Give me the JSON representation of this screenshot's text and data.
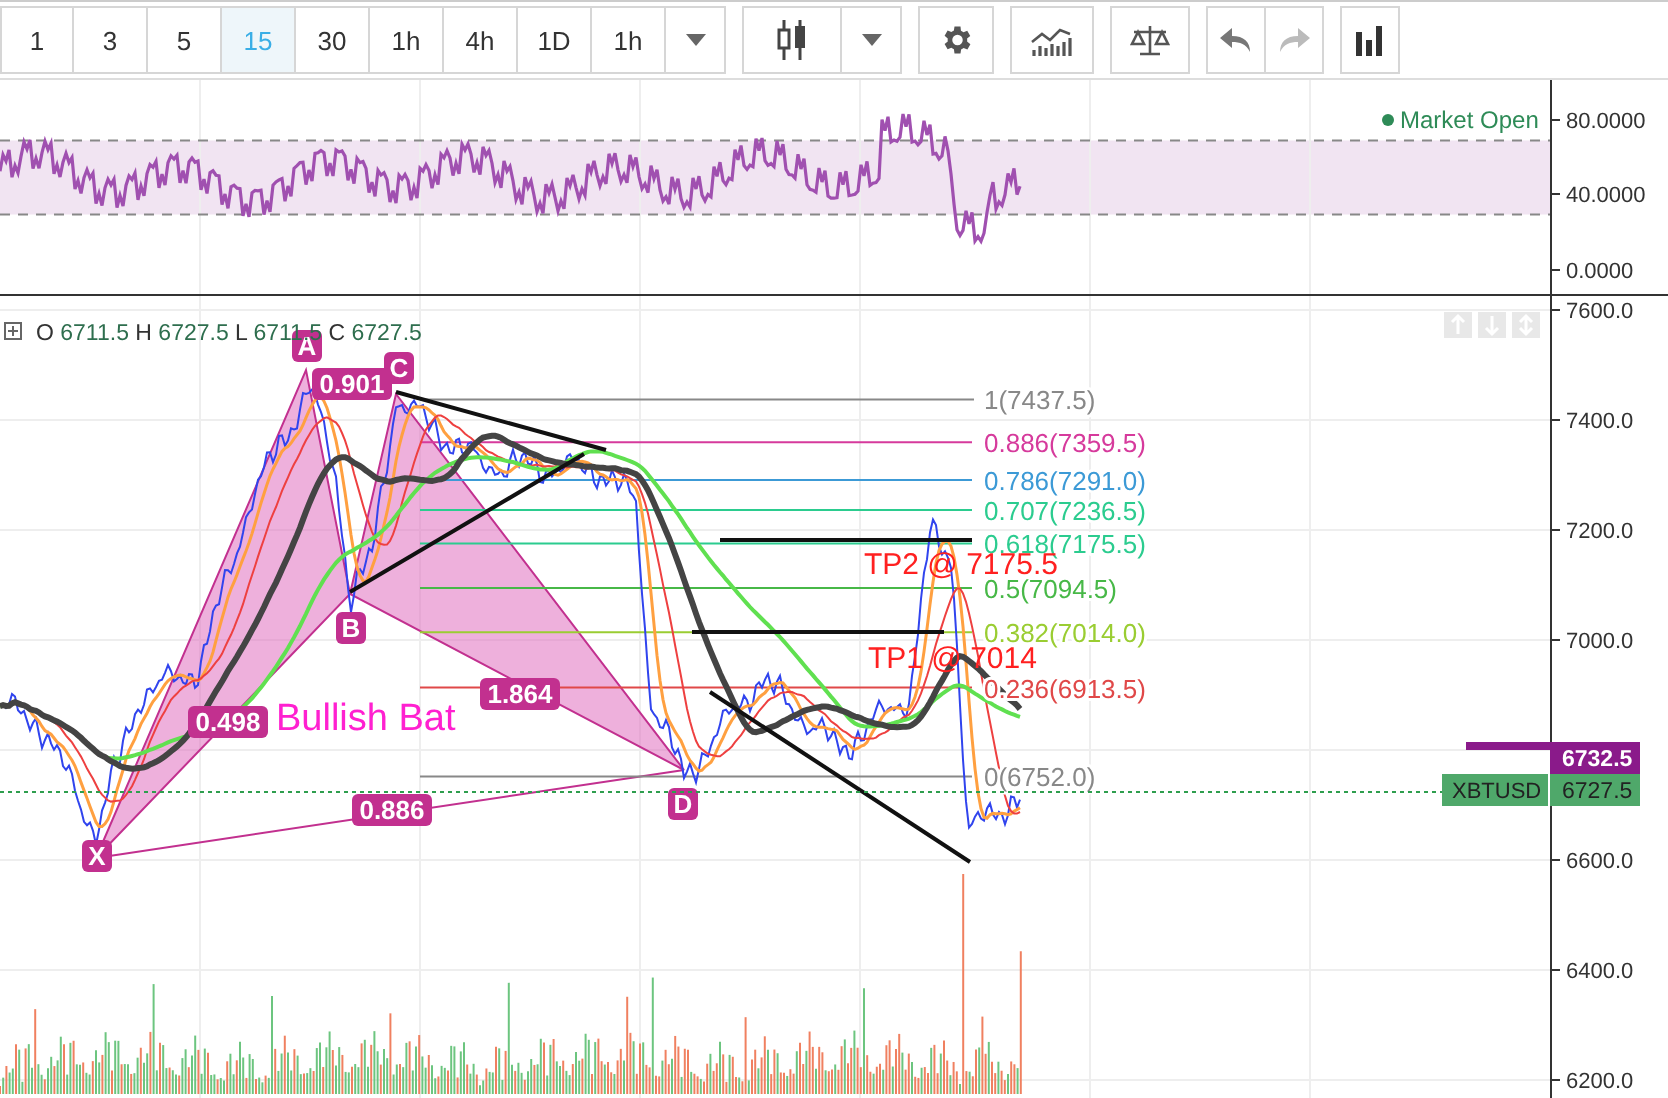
{
  "toolbar": {
    "intervals": [
      {
        "label": "1",
        "selected": false
      },
      {
        "label": "3",
        "selected": false
      },
      {
        "label": "5",
        "selected": false
      },
      {
        "label": "15",
        "selected": true
      },
      {
        "label": "30",
        "selected": false
      },
      {
        "label": "1h",
        "selected": false
      },
      {
        "label": "4h",
        "selected": false
      },
      {
        "label": "1D",
        "selected": false
      },
      {
        "label": "1h",
        "selected": false
      }
    ]
  },
  "rsi_pane": {
    "status": "Market Open",
    "axis_labels": [
      "80.0000",
      "40.0000",
      "0.0000"
    ]
  },
  "main_pane": {
    "ohlc": [
      {
        "key": "O",
        "value": "6711.5"
      },
      {
        "key": "H",
        "value": "6727.5"
      },
      {
        "key": "L",
        "value": "6711.5"
      },
      {
        "key": "C",
        "value": "6727.5"
      }
    ],
    "pattern_name": "Bullish Bat",
    "pattern_points": [
      "X",
      "A",
      "B",
      "C",
      "D"
    ],
    "pattern_ratios": [
      "0.901",
      "0.498",
      "1.864",
      "0.886"
    ],
    "fib_levels": [
      {
        "label": "1(7437.5)",
        "color": "#888888"
      },
      {
        "label": "0.886(7359.5)",
        "color": "#d63a9c"
      },
      {
        "label": "0.786(7291.0)",
        "color": "#3c9ad6"
      },
      {
        "label": "0.707(7236.5)",
        "color": "#2bcc8f"
      },
      {
        "label": "0.618(7175.5)",
        "color": "#2bcc8f"
      },
      {
        "label": "0.5(7094.5)",
        "color": "#47b847"
      },
      {
        "label": "0.382(7014.0)",
        "color": "#9acd32"
      },
      {
        "label": "0.236(6913.5)",
        "color": "#e04848"
      },
      {
        "label": "0(6752.0)",
        "color": "#888888"
      }
    ],
    "targets": [
      "TP2 @ 7175.5",
      "TP1 @ 7014"
    ],
    "price_axis": [
      "7600.0",
      "7400.0",
      "7200.0",
      "7000.0",
      "6600.0",
      "6400.0",
      "6200.0"
    ],
    "last_price": "6732.5",
    "symbol_tag": {
      "symbol": "XBTUSD",
      "price": "6727.5"
    }
  }
}
